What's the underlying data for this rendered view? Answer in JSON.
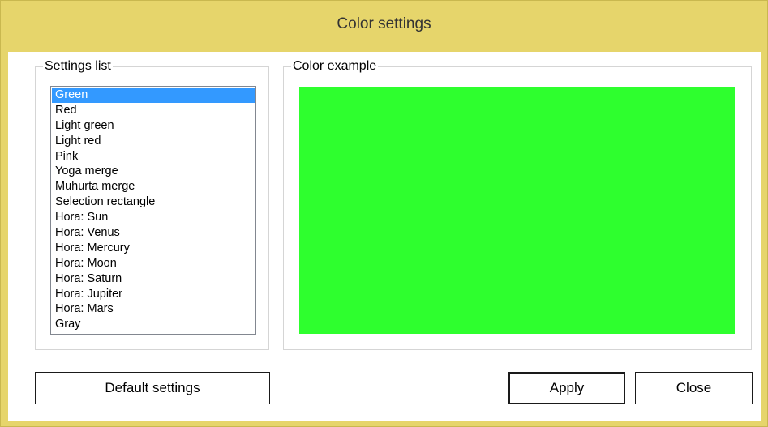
{
  "window": {
    "title": "Color settings",
    "frame_color": "#e6d56b"
  },
  "settings_list": {
    "legend": "Settings list",
    "selected_index": 0,
    "items": [
      "Green",
      "Red",
      "Light green",
      "Light red",
      "Pink",
      "Yoga merge",
      "Muhurta merge",
      "Selection rectangle",
      "Hora: Sun",
      "Hora: Venus",
      "Hora: Mercury",
      "Hora: Moon",
      "Hora: Saturn",
      "Hora: Jupiter",
      "Hora: Mars",
      "Gray"
    ]
  },
  "color_example": {
    "legend": "Color example",
    "color": "#2eff2e"
  },
  "buttons": {
    "default_settings": "Default settings",
    "apply": "Apply",
    "close": "Close"
  }
}
